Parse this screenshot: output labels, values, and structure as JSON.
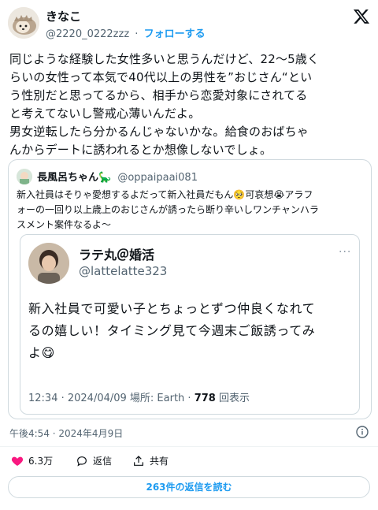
{
  "author": {
    "display_name": "きなこ",
    "handle": "@2220_0222zzz",
    "separator": "·",
    "follow_label": "フォローする"
  },
  "tweet_text": "同じような経験した女性多いと思うんだけど、22〜5歳く\nらいの女性って本気で40代以上の男性を”おじさん“とい\nう性別だと思ってるから、相手から恋愛対象にされてる\nと考えてないし警戒心薄いんだよ。\n男女逆転したら分かるんじゃないかな。給食のおばちゃ\nんからデートに誘われるとか想像しないでしょ。",
  "quote": {
    "display_name": "長風呂ちゃん🦕",
    "handle": "@oppaipaai081",
    "text": "新入社員はそりゃ愛想するよだって新入社員だもん🥺可哀想😭アラフ\nォーの一回り以上歳上のおじさんが誘ったら断り辛いしワンチャンハラ\nスメント案件なるよ〜",
    "inner": {
      "display_name": "ラテ丸＠婚活",
      "handle": "@lattelatte323",
      "text": "新入社員で可愛い子とちょっとずつ仲良くなれて\nるの嬉しい！タイミング見て今週末ご飯誘ってみ\nよ😋",
      "time": "12:34 · 2024/04/09 場所: Earth · ",
      "views_count": "778",
      "views_label": " 回表示"
    }
  },
  "timestamp": "午後4:54 · 2024年4月9日",
  "actions": {
    "likes": "6.3万",
    "reply_label": "返信",
    "share_label": "共有"
  },
  "read_replies_label": "263件の返信を読む",
  "colors": {
    "accent": "#1d9bf0",
    "like": "#f91880",
    "text": "#0f1419",
    "muted": "#536471"
  }
}
